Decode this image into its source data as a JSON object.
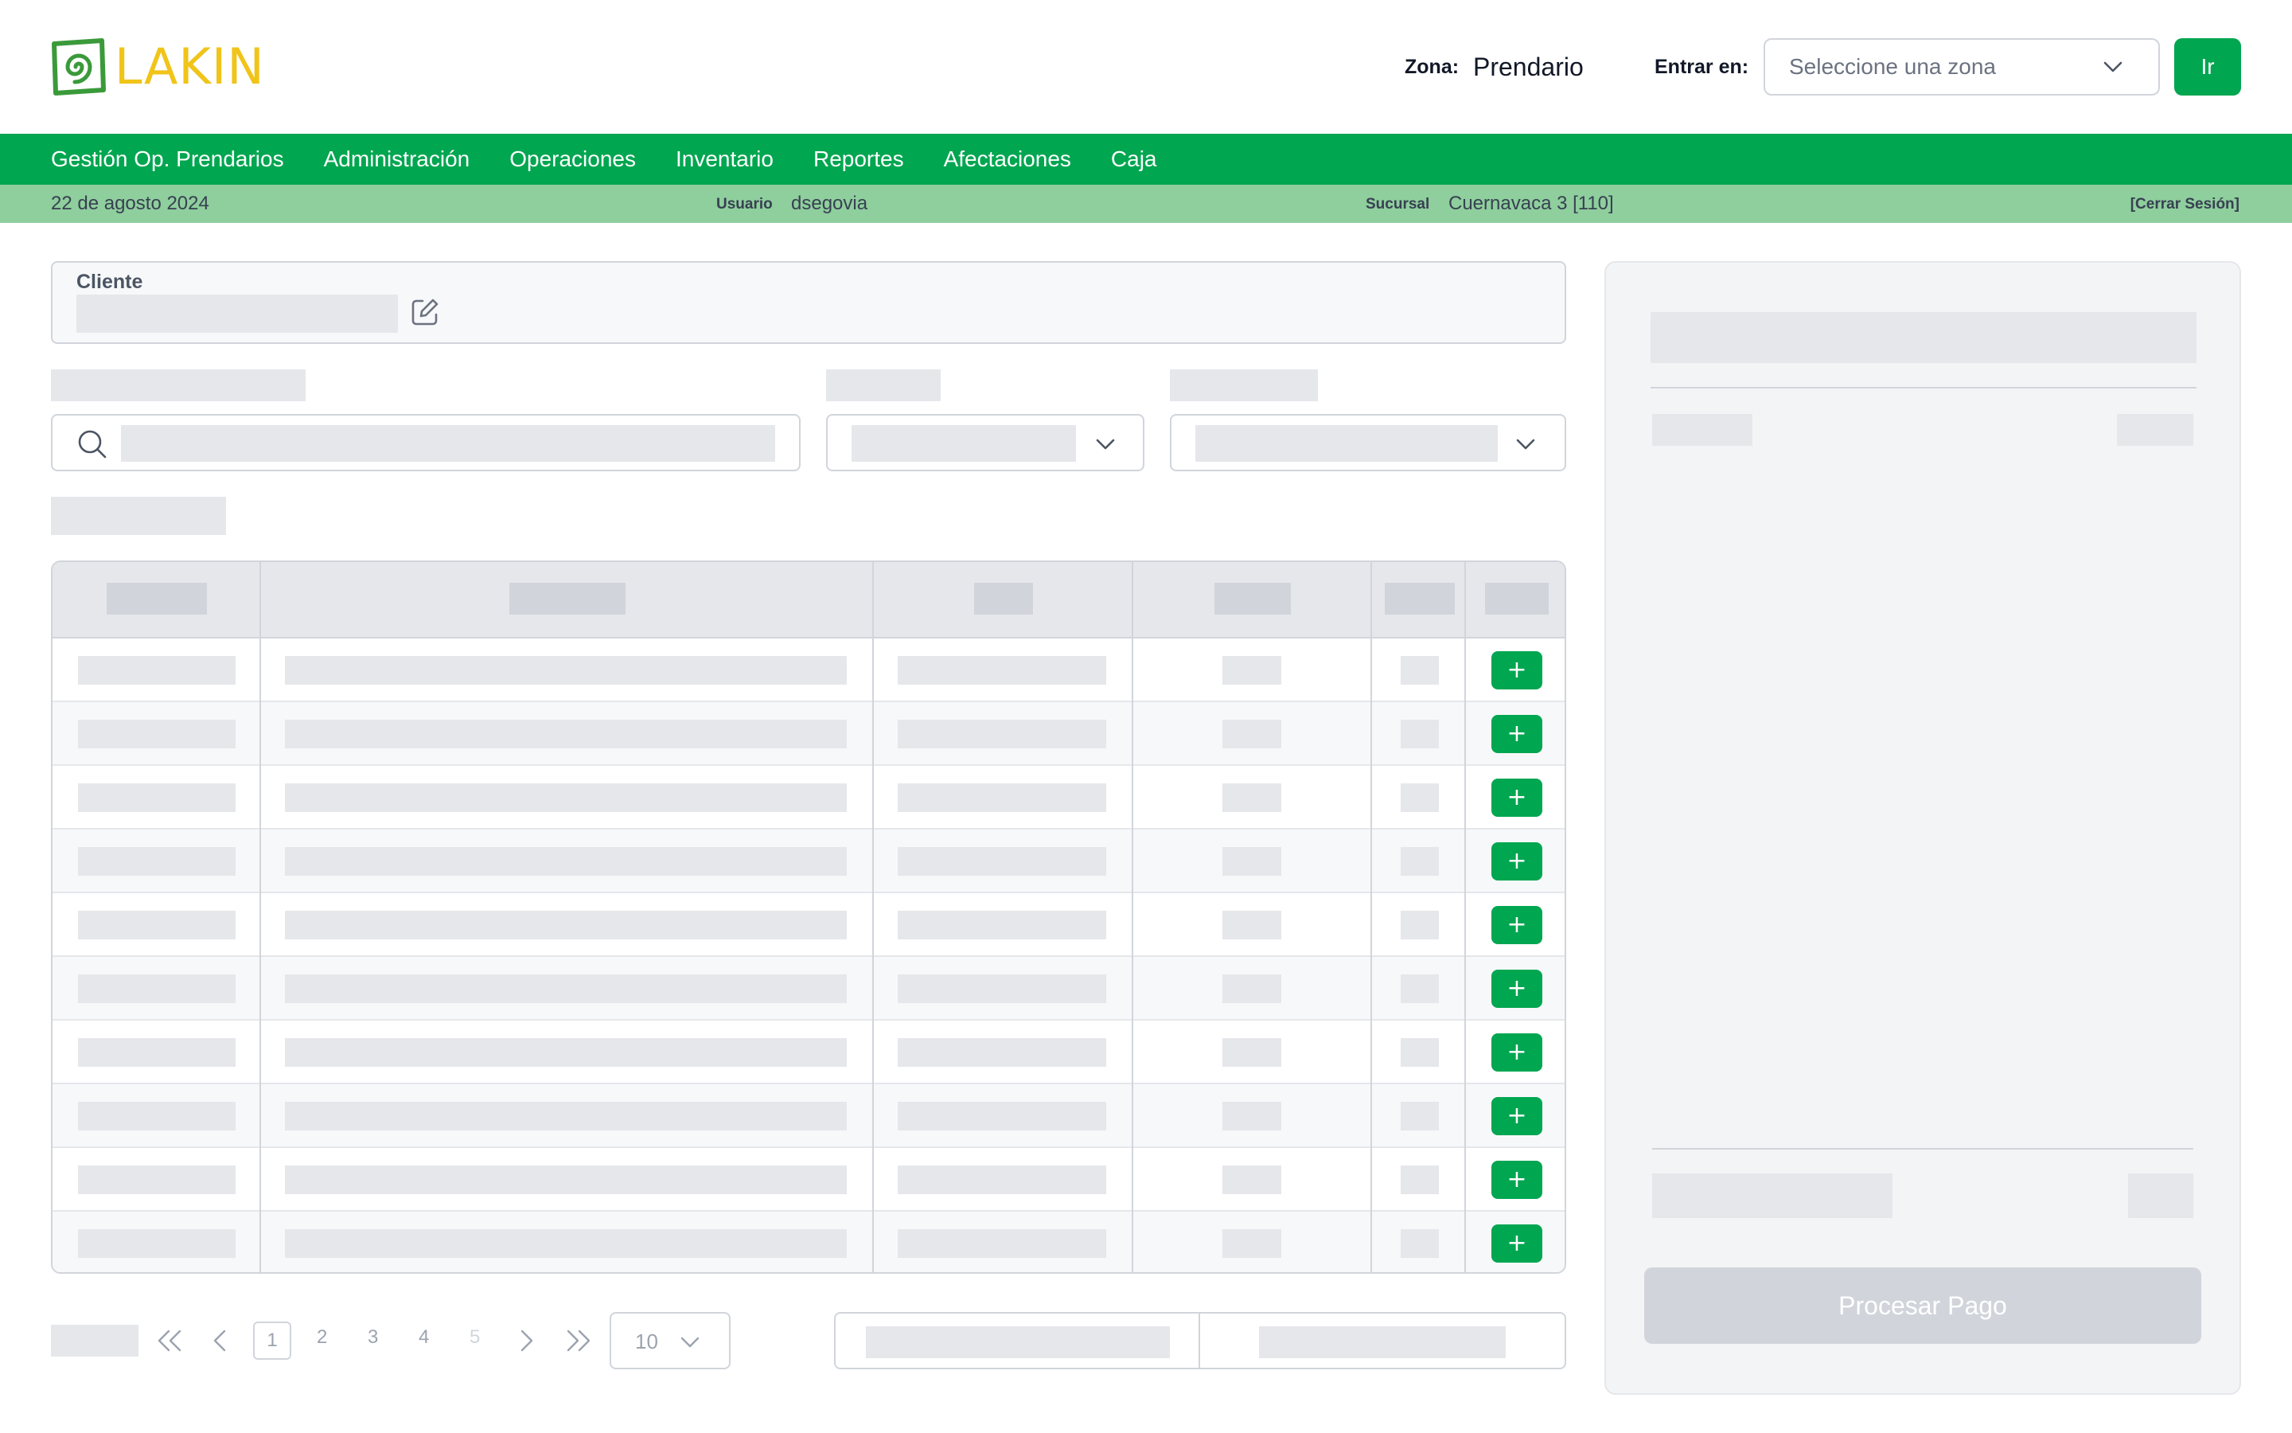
{
  "header": {
    "logo_text": "LAKIN",
    "zona_label": "Zona:",
    "zona_value": "Prendario",
    "entrar_label": "Entrar en:",
    "zone_select_placeholder": "Seleccione una zona",
    "go_label": "Ir"
  },
  "nav": {
    "items": [
      {
        "label": "Gestión Op. Prendarios"
      },
      {
        "label": "Administración"
      },
      {
        "label": "Operaciones"
      },
      {
        "label": "Inventario"
      },
      {
        "label": "Reportes"
      },
      {
        "label": "Afectaciones"
      },
      {
        "label": "Caja"
      }
    ]
  },
  "info": {
    "date": "22 de agosto 2024",
    "user_label": "Usuario",
    "user": "dsegovia",
    "branch_label": "Sucursal",
    "branch": "Cuernavaca 3 [110]",
    "logout": "[Cerrar Sesión]"
  },
  "client": {
    "label": "Cliente"
  },
  "table": {
    "row_count": 10,
    "add_label": "+"
  },
  "pagination": {
    "pages": [
      "1",
      "2",
      "3",
      "4",
      "5"
    ],
    "current_page": "1",
    "page_size": "10"
  },
  "panel": {
    "pay_label": "Procesar Pago"
  },
  "colors": {
    "brand_green": "#00a650",
    "info_bar": "#8fce9d",
    "logo_yellow": "#f0c419",
    "skeleton": "#e5e7eb"
  },
  "icons": {
    "logo": "spiral-logo-icon",
    "dropdown": "chevron-down-icon",
    "edit": "edit-icon",
    "search": "search-icon",
    "first": "chevrons-left-icon",
    "prev": "chevron-left-icon",
    "next": "chevron-right-icon",
    "last": "chevrons-right-icon"
  }
}
